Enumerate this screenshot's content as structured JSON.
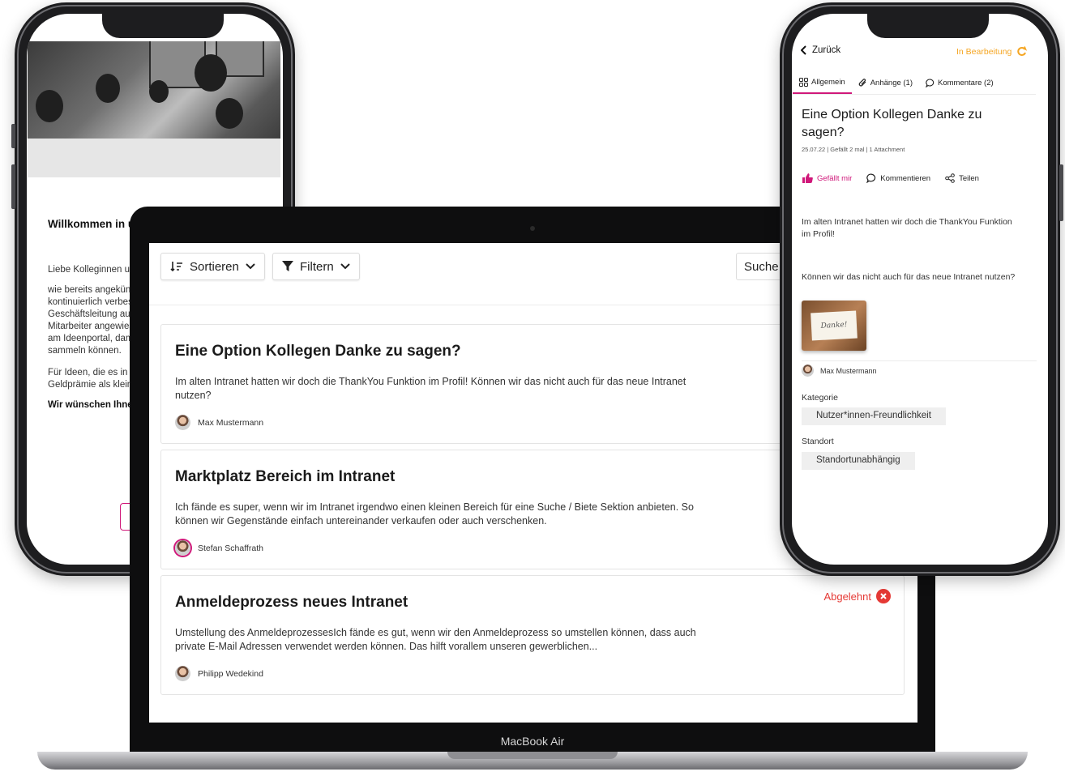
{
  "left_phone": {
    "title": "Willkommen in un",
    "greeting": "Liebe Kolleginnen und",
    "paragraph1": [
      "wie bereits angekündi",
      "kontinuierlich verbess",
      "Geschäftsleitung auf V",
      "Mitarbeiter angewiese",
      "am Ideenportal, damit",
      "sammeln können."
    ],
    "paragraph2": [
      "Für Ideen, die es in die",
      "Geldprämie als kleine"
    ],
    "closing": "Wir wünschen Ihnen"
  },
  "laptop": {
    "brand": "MacBook Air",
    "toolbar": {
      "sort_label": "Sortieren",
      "filter_label": "Filtern",
      "search_value": "Suche"
    },
    "ideas": [
      {
        "title": "Eine Option Kollegen Danke zu sagen?",
        "text": "Im alten Intranet hatten wir doch die ThankYou Funktion im Profil! Können wir das nicht auch für das neue Intranet nutzen?",
        "author": "Max Mustermann",
        "status": ""
      },
      {
        "title": "Marktplatz Bereich im Intranet",
        "text": "Ich fände es super, wenn wir im Intranet irgendwo einen kleinen Bereich für eine Suche / Biete Sektion anbieten. So können wir Gegenstände einfach untereinander verkaufen oder auch verschenken.",
        "author": "Stefan Schaffrath",
        "status": ""
      },
      {
        "title": "Anmeldeprozess neues Intranet",
        "text": "Umstellung des AnmeldeprozessesIch fände es gut, wenn wir den Anmeldeprozess so umstellen können, dass auch private E-Mail Adressen verwendet werden können. Das hilft vorallem unseren gewerblichen...",
        "author": "Philipp Wedekind",
        "status": "Abgelehnt"
      }
    ]
  },
  "right_phone": {
    "back_label": "Zurück",
    "status_label": "In Bearbeitung",
    "tabs": [
      {
        "label": "Allgemein",
        "icon": "grid-icon"
      },
      {
        "label": "Anhänge (1)",
        "icon": "paperclip-icon"
      },
      {
        "label": "Kommentare (2)",
        "icon": "comment-icon"
      }
    ],
    "title": "Eine Option Kollegen Danke zu sagen?",
    "meta": "25.07.22   |   Gefällt 2 mal   |   1 Attachment",
    "actions": {
      "like": "Gefällt mir",
      "comment": "Kommentieren",
      "share": "Teilen"
    },
    "body1": "Im alten Intranet hatten wir doch die ThankYou Funktion im Profil!",
    "body2": "Können wir das nicht auch für das neue Intranet nutzen?",
    "image_note": "Danke!",
    "author": "Max Mustermann",
    "category_label": "Kategorie",
    "category_value": "Nutzer*innen-Freundlichkeit",
    "location_label": "Standort",
    "location_value": "Standortunabhängig"
  },
  "colors": {
    "accent_pink": "#d0187a",
    "status_orange": "#f5a623",
    "rejected_red": "#e53935"
  }
}
